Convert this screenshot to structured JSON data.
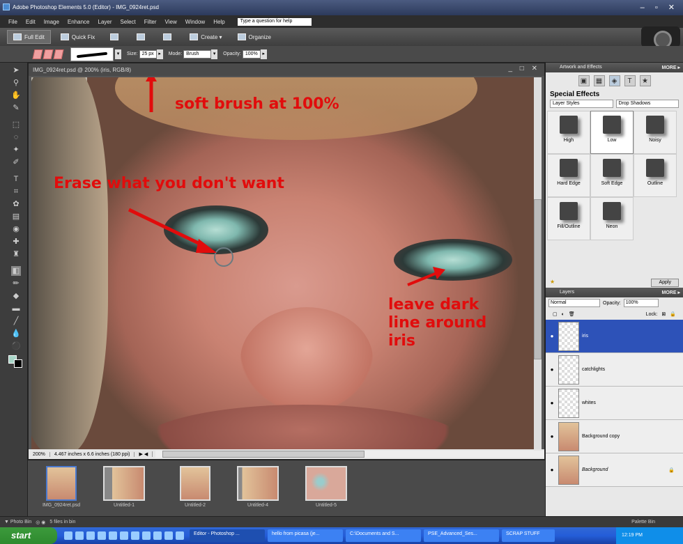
{
  "title_bar": {
    "title": "Adobe Photoshop Elements 5.0 (Editor) - IMG_0924ret.psd",
    "controls": "– ▫ ✕"
  },
  "menu": {
    "items": [
      "File",
      "Edit",
      "Image",
      "Enhance",
      "Layer",
      "Select",
      "Filter",
      "View",
      "Window",
      "Help"
    ],
    "help_box": "Type a question for help"
  },
  "modebar": {
    "full_edit": "Full Edit",
    "quick_fix": "Quick Fix",
    "create": "Create ▾",
    "organize": "Organize"
  },
  "options": {
    "size_label": "Size:",
    "size_value": "25 px",
    "mode_label": "Mode:",
    "mode_value": "Brush",
    "opacity_label": "Opacity:",
    "opacity_value": "100%"
  },
  "document": {
    "title": "IMG_0924ret.psd @ 200% (iris, RGB/8)",
    "controls": "_ □ ✕",
    "zoom": "200%",
    "dims": "4.467 inches x 6.6 inches (180 ppi)"
  },
  "annotations": {
    "a1": "soft brush at 100%",
    "a2": "Erase what you don't want",
    "a3": "leave dark line around iris"
  },
  "photo_bin": {
    "thumbs": [
      "IMG_0924ret.psd",
      "Untitled-1",
      "Untitled-2",
      "Untitled-4",
      "Untitled-5"
    ]
  },
  "panel": {
    "artwork_title": "Artwork and Effects",
    "more": "MORE ▸",
    "special_effects": "Special Effects",
    "category": "Layer Styles",
    "subcategory": "Drop Shadows",
    "styles": [
      "High",
      "Low",
      "Noisy",
      "Hard Edge",
      "Soft Edge",
      "Outline",
      "Fill/Outline",
      "Neon"
    ],
    "apply": "Apply",
    "layers_title": "Layers",
    "blend": "Normal",
    "opacity_label": "Opacity:",
    "opacity_value": "100%",
    "lock_label": "Lock:",
    "layers": [
      "iris",
      "catchlights",
      "whites",
      "Background copy",
      "Background"
    ]
  },
  "bin_bar": {
    "photo_bin": "Photo Bin",
    "files": "5 files in bin",
    "palette_bin": "Palette Bin"
  },
  "taskbar": {
    "start": "start",
    "tasks": [
      "Editor - Photoshop ...",
      "hello from picasa (je...",
      "C:\\Documents and S...",
      "PSE_Advanced_Ses...",
      "SCRAP STUFF"
    ],
    "clock": "12:19 PM"
  },
  "colors": {
    "accent": "#2d52b8",
    "annotation": "#e10c0c"
  }
}
